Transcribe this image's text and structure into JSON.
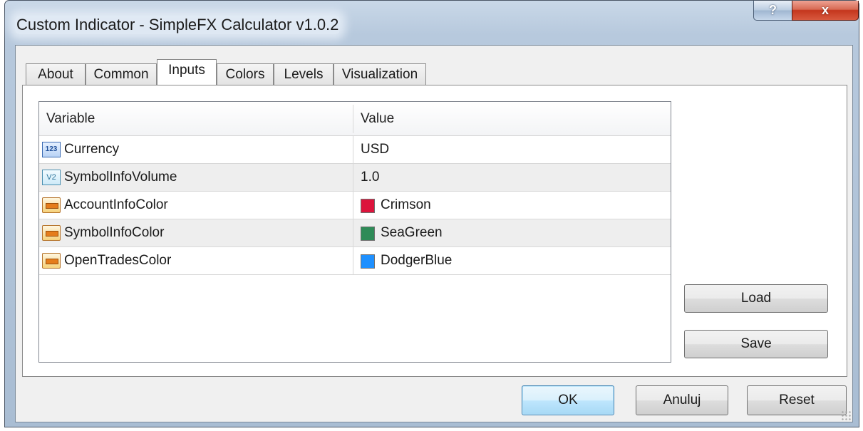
{
  "window": {
    "title": "Custom Indicator - SimpleFX Calculator v1.0.2",
    "help_label": "?",
    "close_label": "x"
  },
  "tabs": [
    {
      "label": "About"
    },
    {
      "label": "Common"
    },
    {
      "label": "Inputs"
    },
    {
      "label": "Colors"
    },
    {
      "label": "Levels"
    },
    {
      "label": "Visualization"
    }
  ],
  "active_tab": "Inputs",
  "grid": {
    "columns": [
      "Variable",
      "Value"
    ],
    "rows": [
      {
        "icon": "integer-type-icon",
        "icon_text": "123",
        "variable": "Currency",
        "value": "USD"
      },
      {
        "icon": "double-type-icon",
        "icon_text": "V2",
        "variable": "SymbolInfoVolume",
        "value": "1.0"
      },
      {
        "icon": "color-type-icon",
        "variable": "AccountInfoColor",
        "value": "Crimson",
        "swatch": "#dc143c"
      },
      {
        "icon": "color-type-icon",
        "variable": "SymbolInfoColor",
        "value": "SeaGreen",
        "swatch": "#2e8b57"
      },
      {
        "icon": "color-type-icon",
        "variable": "OpenTradesColor",
        "value": "DodgerBlue",
        "swatch": "#1e90ff"
      }
    ]
  },
  "side_buttons": {
    "load": "Load",
    "save": "Save"
  },
  "footer_buttons": {
    "ok": "OK",
    "cancel": "Anuluj",
    "reset": "Reset"
  }
}
